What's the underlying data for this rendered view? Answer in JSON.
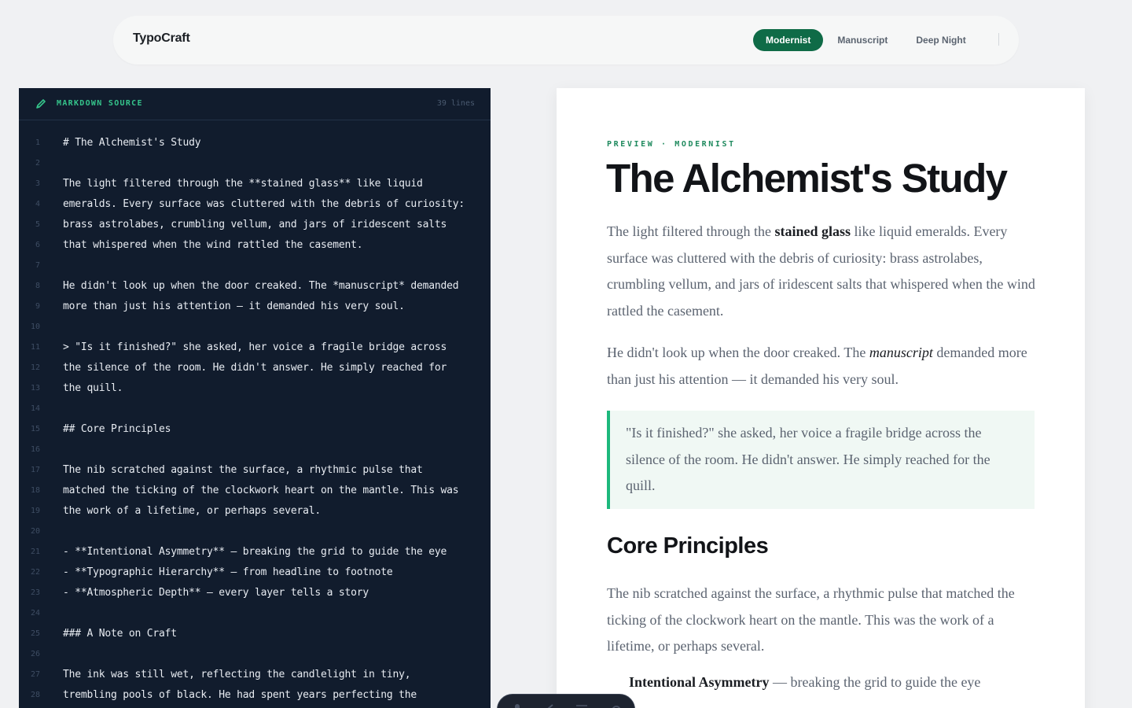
{
  "app": {
    "brand": "TypoCraft",
    "themes": [
      {
        "label": "Modernist",
        "active": true
      },
      {
        "label": "Manuscript",
        "active": false
      },
      {
        "label": "Deep Night",
        "active": false
      }
    ],
    "accent_color": "#0f6b47"
  },
  "editor": {
    "title": "MARKDOWN SOURCE",
    "line_count": "39 lines",
    "lines": [
      "# The Alchemist's Study",
      "",
      "The light filtered through the **stained glass** like liquid",
      "emeralds. Every surface was cluttered with the debris of curiosity:",
      "brass astrolabes, crumbling vellum, and jars of iridescent salts",
      "that whispered when the wind rattled the casement.",
      "",
      "He didn't look up when the door creaked. The *manuscript* demanded",
      "more than just his attention — it demanded his very soul.",
      "",
      "> \"Is it finished?\" she asked, her voice a fragile bridge across",
      "the silence of the room. He didn't answer. He simply reached for",
      "the quill.",
      "",
      "## Core Principles",
      "",
      "The nib scratched against the surface, a rhythmic pulse that",
      "matched the ticking of the clockwork heart on the mantle. This was",
      "the work of a lifetime, or perhaps several.",
      "",
      "- **Intentional Asymmetry** — breaking the grid to guide the eye",
      "- **Typographic Hierarchy** — from headline to footnote",
      "- **Atmospheric Depth** — every layer tells a story",
      "",
      "### A Note on Craft",
      "",
      "The ink was still wet, reflecting the candlelight in tiny,",
      "trembling pools of black. He had spent years perfecting the"
    ]
  },
  "preview": {
    "kicker": "PREVIEW · MODERNIST",
    "title": "The Alchemist's Study",
    "p1": {
      "before": "The light filtered through the ",
      "bold": "stained glass",
      "after": " like liquid emeralds. Every surface was cluttered with the debris of curiosity: brass astrolabes, crumbling vellum, and jars of iridescent salts that whispered when the wind rattled the casement."
    },
    "p2": {
      "before": "He didn't look up when the door creaked. The ",
      "italic": "manuscript",
      "after": " demanded more than just his attention — it demanded his very soul."
    },
    "quote": "\"Is it finished?\" she asked, her voice a fragile bridge across the silence of the room. He didn't answer. He simply reached for the quill.",
    "h2": "Core Principles",
    "p3": "The nib scratched against the surface, a rhythmic pulse that matched the ticking of the clockwork heart on the mantle. This was the work of a lifetime, or perhaps several.",
    "list": [
      {
        "bold": "Intentional Asymmetry",
        "rest": " — breaking the grid to guide the eye"
      }
    ]
  }
}
